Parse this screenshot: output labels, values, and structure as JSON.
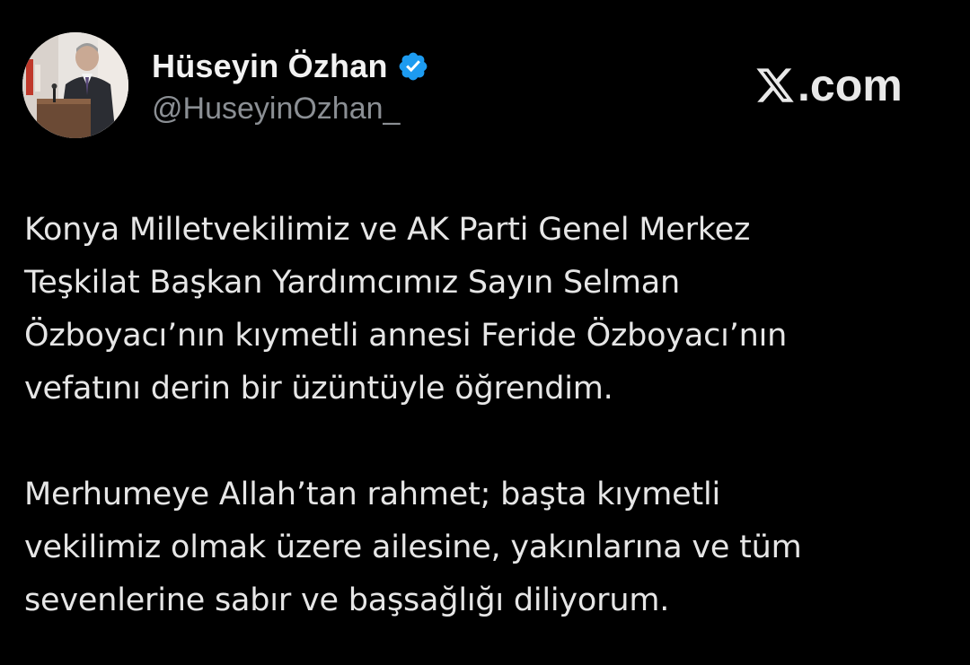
{
  "author": {
    "display_name": "Hüseyin Özhan",
    "handle": "@HuseyinOzhan_",
    "verified": true,
    "verified_color": "#1d9bf0"
  },
  "brand": {
    "text": ".com",
    "icon": "x-logo-icon"
  },
  "tweet": {
    "paragraphs": [
      {
        "lines": [
          "Konya Milletvekilimiz ve AK Parti Genel Merkez",
          "Teşkilat Başkan Yardımcımız Sayın Selman",
          "Özboyacı’nın kıymetli annesi Feride Özboyacı’nın",
          "vefatını derin bir üzüntüyle öğrendim."
        ]
      },
      {
        "lines": [
          "Merhumeye Allah’tan rahmet; başta kıymetli",
          "vekilimiz olmak üzere ailesine, yakınlarına ve tüm",
          "sevenlerine sabır ve başsağlığı diliyorum."
        ]
      }
    ]
  },
  "colors": {
    "background": "#000000",
    "text": "#e6e6e6",
    "handle": "#8b8f94"
  }
}
